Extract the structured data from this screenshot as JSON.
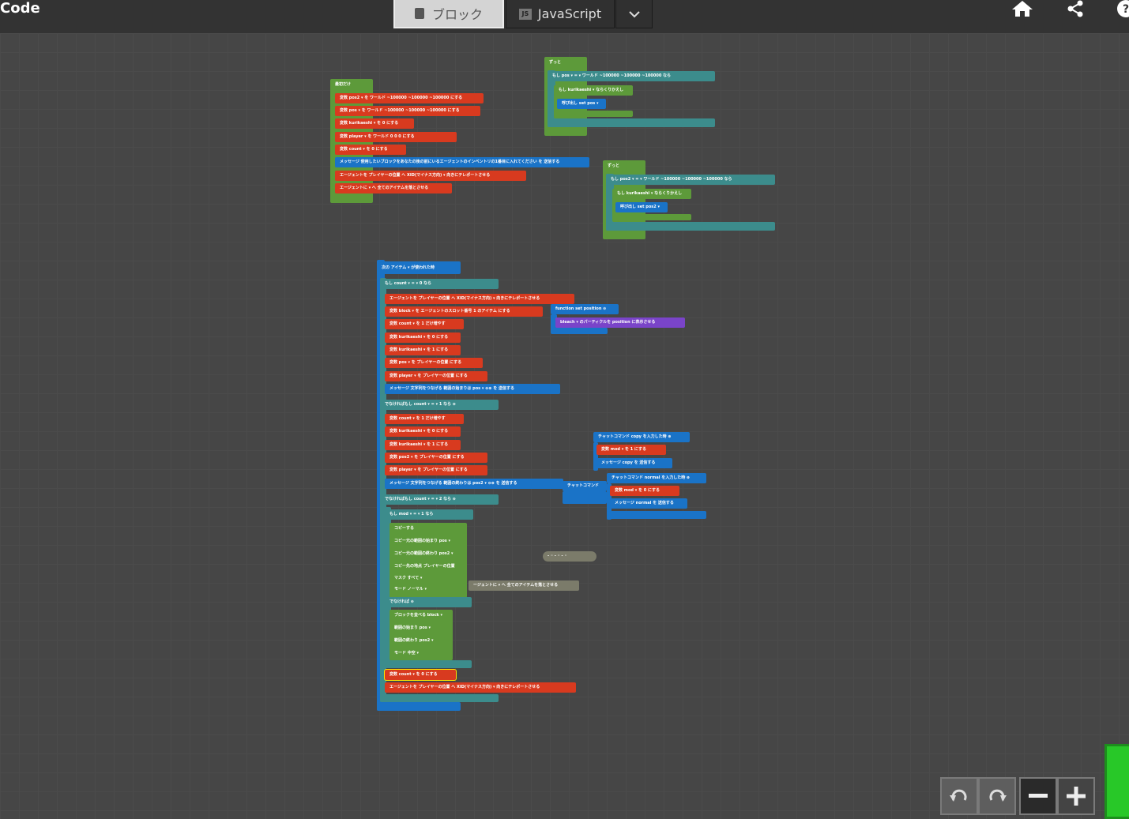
{
  "app": {
    "title": "Code"
  },
  "modes": {
    "blocks": "ブロック",
    "javascript": "JavaScript"
  },
  "blocks": {
    "start": {
      "header": "最初だけ",
      "l1": "変数 pos2 ▾ を ワールド ~100000 ~100000 ~100000 にする",
      "l2": "変数 pos ▾ を ワールド ~100000 ~100000 ~100000 にする",
      "l3": "変数 kurikaeshi ▾ を 0 にする",
      "l4": "変数 player ▾ を ワールド 0 0 0 にする",
      "l5": "変数 count ▾ を 0 にする",
      "l6": "メッセージ 使用したいブロックをあなたの後の前にいるエージェントのインベントリの1番目に入れてください を 送信する",
      "l7": "エージェントを プレイヤーの位置 へ XID(マイナス方向) ▾ 向きにテレポートさせる",
      "l8": "エージェントに ▾ へ 全てのアイテムを落とさせる"
    },
    "forever1": {
      "header": "ずっと",
      "if": "もし pos ▾ = ▾ ワールド ~100000 ~100000 ~100000 なら",
      "inner": "もし kurikaeshi ▾ ならくりかえし",
      "call": "呼び出し set pos ▾"
    },
    "forever2": {
      "header": "ずっと",
      "if": "もし pos2 ▾ = ▾ ワールド ~100000 ~100000 ~100000 なら",
      "inner": "もし kurikaeshi ▾ ならくりかえし",
      "call": "呼び出し set pos2 ▾"
    },
    "function": {
      "header": "function set position ⊖",
      "body": "bleach ▾ のパーティクルを position に表示させる"
    },
    "item_event": {
      "header": "次の アイテム ▾ が使われた時",
      "if1": "もし count ▾ = ▾ 0 なら",
      "a1": "エージェントを プレイヤーの位置 へ XID(マイナス方向) ▾ 向きにテレポートさせる",
      "a2": "変数 block ▾ を エージェントのスロット番号 1 のアイテム にする",
      "a3": "変数 count ▾ を 1 だけ増やす",
      "a4": "変数 kurikaeshi ▾ を 0 にする",
      "a5": "変数 kurikaeshi ▾ を 1 にする",
      "a6": "変数 pos ▾ を プレイヤーの位置 にする",
      "a7": "変数 player ▾ を プレイヤーの位置 にする",
      "a8": "メッセージ 文字列をつなげる 範囲の始まりは pos ▾ ⊖⊕ を 送信する",
      "elif1": "でなければもし count ▾ = ▾ 1 なら ⊖",
      "b1": "変数 count ▾ を 1 だけ増やす",
      "b2": "変数 kurikaeshi ▾ を 0 にする",
      "b3": "変数 kurikaeshi ▾ を 1 にする",
      "b4": "変数 pos2 ▾ を プレイヤーの位置 にする",
      "b5": "変数 player ▾ を プレイヤーの位置 にする",
      "b6": "メッセージ 文字列をつなげる 範囲の終わりは pos2 ▾ ⊖⊕ を 送信する",
      "elif2": "でなければもし count ▾ = ▾ 2 なら ⊖",
      "c_if": "もし mod ▾ = ▾ 1 なら",
      "c1": "コピーする",
      "c2": "コピー元の範囲の始まり pos ▾",
      "c3": "コピー元の範囲の終わり pos2 ▾",
      "c4": "コピー先の地点 プレイヤーの位置",
      "c5": "マスク すべて ▾",
      "c6": "モード ノーマル ▾",
      "c_else": "でなければ ⊖",
      "d1": "ブロックを並べる block ▾",
      "d2": "範囲の始まり pos ▾",
      "d3": "範囲の終わり pos2 ▾",
      "d4": "モード 中空 ▾",
      "e1": "変数 count ▾ を 0 にする",
      "e2": "エージェントを プレイヤーの位置 へ XID(マイナス方向) ▾ 向きにテレポートさせる"
    },
    "chat1": {
      "header": "チャットコマンド copy を入力した時 ⊕",
      "l1": "変数 mod ▾ を 1 にする",
      "l2": "メッセージ copy を 送信する"
    },
    "chat2": {
      "header": "チャットコマンド normal を入力した時 ⊕",
      "l1": "変数 mod ▾ を 0 にする",
      "l2": "メッセージ normal を 送信する"
    },
    "chat_stub": "チャットコマンド",
    "stray_agent": "ージェントに ▾ へ 全てのアイテムを落とさせる",
    "stray_math": "- ◦ - ◦ - ◦"
  }
}
